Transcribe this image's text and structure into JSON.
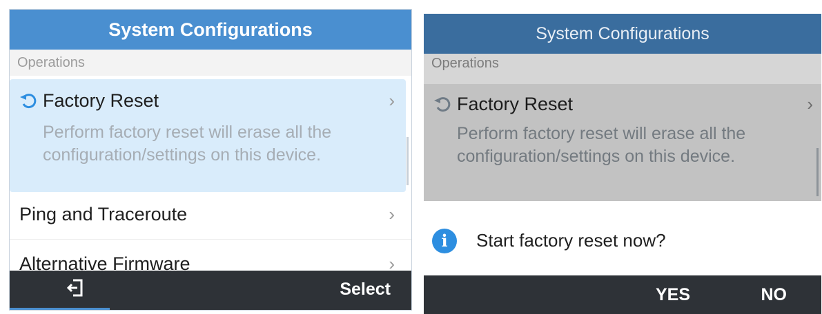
{
  "left": {
    "title": "System Configurations",
    "section": "Operations",
    "items": [
      {
        "title": "Factory Reset",
        "description": "Perform factory reset will erase all the configuration/settings on this device."
      },
      {
        "title": "Ping and Traceroute"
      },
      {
        "title": "Alternative Firmware"
      }
    ],
    "softkeys": {
      "back_icon": "exit-icon",
      "select_label": "Select"
    }
  },
  "right": {
    "title": "System Configurations",
    "section": "Operations",
    "item": {
      "title": "Factory Reset",
      "description": "Perform factory reset will erase all the configuration/settings on this device."
    },
    "dialog": {
      "icon": "info-icon",
      "icon_glyph": "i",
      "message": "Start factory reset now?"
    },
    "softkeys": {
      "yes_label": "YES",
      "no_label": "NO"
    }
  },
  "colors": {
    "title_bar": "#4a8fd0",
    "selected_row": "#d9ecfb",
    "softkey_bar": "#2e3237",
    "info_icon": "#2d8ee0"
  },
  "glyphs": {
    "chevron": "›"
  }
}
